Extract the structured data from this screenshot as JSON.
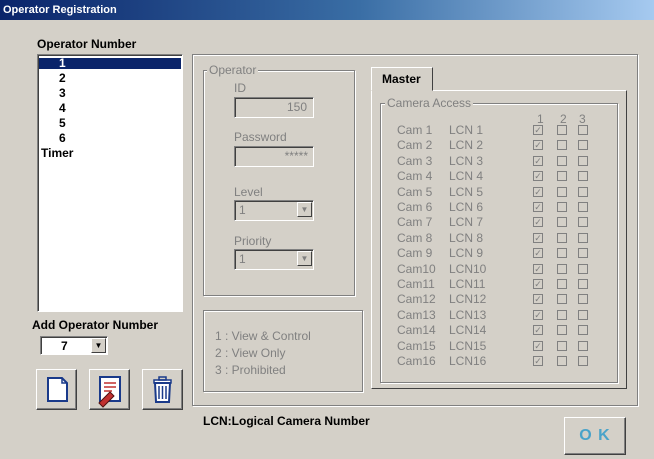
{
  "window": {
    "title": "Operator Registration"
  },
  "operator_number_label": "Operator Number",
  "operators": [
    "1",
    "2",
    "3",
    "4",
    "5",
    "6",
    "Timer"
  ],
  "selected_operator": "1",
  "add_operator": {
    "label": "Add Operator Number",
    "value": "7"
  },
  "operator_group": {
    "legend": "Operator",
    "id_label": "ID",
    "id_value": "150",
    "password_label": "Password",
    "password_value": "*****",
    "level_label": "Level",
    "level_value": "1",
    "priority_label": "Priority",
    "priority_value": "1"
  },
  "legend_box": {
    "line1": "1 : View & Control",
    "line2": "2 : View Only",
    "line3": "3 : Prohibited"
  },
  "tab": {
    "label": "Master"
  },
  "camera_access": {
    "legend": "Camera Access",
    "columns": [
      "1",
      "2",
      "3"
    ],
    "rows": [
      {
        "cam": "Cam 1",
        "lcn": "LCN 1"
      },
      {
        "cam": "Cam 2",
        "lcn": "LCN 2"
      },
      {
        "cam": "Cam 3",
        "lcn": "LCN 3"
      },
      {
        "cam": "Cam 4",
        "lcn": "LCN 4"
      },
      {
        "cam": "Cam 5",
        "lcn": "LCN 5"
      },
      {
        "cam": "Cam 6",
        "lcn": "LCN 6"
      },
      {
        "cam": "Cam 7",
        "lcn": "LCN 7"
      },
      {
        "cam": "Cam 8",
        "lcn": "LCN 8"
      },
      {
        "cam": "Cam 9",
        "lcn": "LCN 9"
      },
      {
        "cam": "Cam10",
        "lcn": "LCN10"
      },
      {
        "cam": "Cam11",
        "lcn": "LCN11"
      },
      {
        "cam": "Cam12",
        "lcn": "LCN12"
      },
      {
        "cam": "Cam13",
        "lcn": "LCN13"
      },
      {
        "cam": "Cam14",
        "lcn": "LCN14"
      },
      {
        "cam": "Cam15",
        "lcn": "LCN15"
      },
      {
        "cam": "Cam16",
        "lcn": "LCN16"
      }
    ],
    "checked_column": "1"
  },
  "footer_note": "LCN:Logical Camera Number",
  "ok_button": "O K",
  "icons": {
    "new": "new-document-icon",
    "edit": "edit-document-icon",
    "delete": "trash-icon"
  },
  "colors": {
    "title_start": "#0a246a",
    "title_end": "#a6caf0",
    "ok_text": "#4aa3c9",
    "dialog": "#d4d0c8"
  }
}
